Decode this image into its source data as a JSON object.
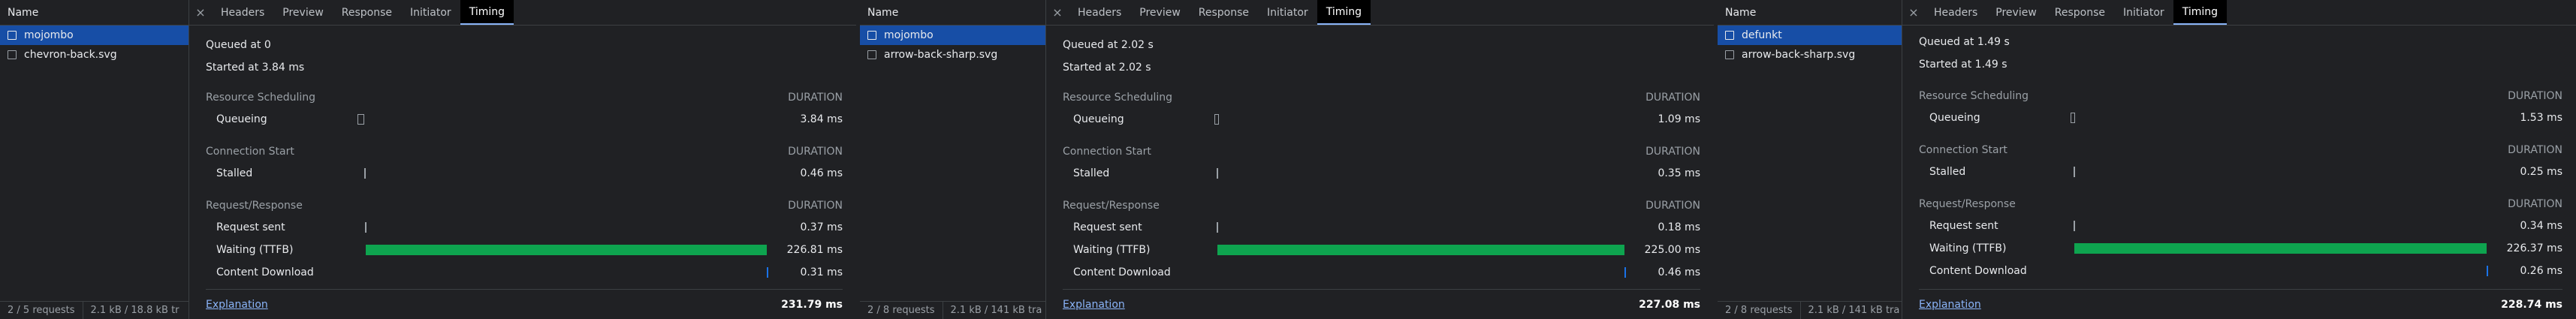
{
  "common": {
    "name_header": "Name",
    "tabs": [
      "Headers",
      "Preview",
      "Response",
      "Initiator",
      "Timing"
    ],
    "active_tab": "Timing",
    "close_glyph": "×",
    "sections": {
      "scheduling": "Resource Scheduling",
      "connection": "Connection Start",
      "request": "Request/Response",
      "duration": "DURATION"
    },
    "rows": {
      "queueing": "Queueing",
      "stalled": "Stalled",
      "sent": "Request sent",
      "waiting": "Waiting (TTFB)",
      "download": "Content Download"
    },
    "explanation": "Explanation",
    "colors": {
      "waiting": "#0ea44f",
      "download": "#1a73e8",
      "selected": "#174ea6",
      "link": "#8ab4f8"
    }
  },
  "panels": [
    {
      "list": [
        {
          "name": "mojombo",
          "selected": true
        },
        {
          "name": "chevron-back.svg",
          "selected": false
        }
      ],
      "status_requests": "2 / 5 requests",
      "status_transfer": "2.1 kB / 18.8 kB tr",
      "queued": "Queued at 0",
      "started": "Started at 3.84 ms",
      "queueing": "3.84 ms",
      "stalled": "0.46 ms",
      "sent": "0.37 ms",
      "waiting": "226.81 ms",
      "download": "0.31 ms",
      "total": "231.79 ms",
      "ms": {
        "queueing": 3.84,
        "stalled": 0.46,
        "sent": 0.37,
        "waiting": 226.81,
        "download": 0.31,
        "total": 231.79
      }
    },
    {
      "list": [
        {
          "name": "mojombo",
          "selected": true
        },
        {
          "name": "arrow-back-sharp.svg",
          "selected": false
        }
      ],
      "status_requests": "2 / 8 requests",
      "status_transfer": "2.1 kB / 141 kB tra",
      "queued": "Queued at 2.02 s",
      "started": "Started at 2.02 s",
      "queueing": "1.09 ms",
      "stalled": "0.35 ms",
      "sent": "0.18 ms",
      "waiting": "225.00 ms",
      "download": "0.46 ms",
      "total": "227.08 ms",
      "ms": {
        "queueing": 1.09,
        "stalled": 0.35,
        "sent": 0.18,
        "waiting": 225.0,
        "download": 0.46,
        "total": 227.08
      }
    },
    {
      "list": [
        {
          "name": "defunkt",
          "selected": true
        },
        {
          "name": "arrow-back-sharp.svg",
          "selected": false
        }
      ],
      "status_requests": "2 / 8 requests",
      "status_transfer": "2.1 kB / 141 kB tra",
      "queued": "Queued at 1.49 s",
      "started": "Started at 1.49 s",
      "queueing": "1.53 ms",
      "stalled": "0.25 ms",
      "sent": "0.34 ms",
      "waiting": "226.37 ms",
      "download": "0.26 ms",
      "total": "228.74 ms",
      "ms": {
        "queueing": 1.53,
        "stalled": 0.25,
        "sent": 0.34,
        "waiting": 226.37,
        "download": 0.26,
        "total": 228.74
      }
    }
  ]
}
